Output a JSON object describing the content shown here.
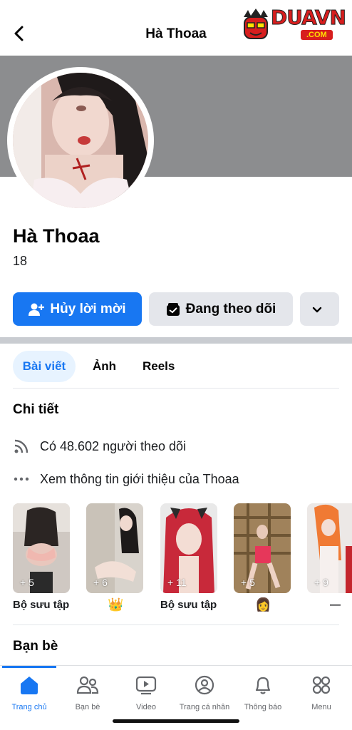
{
  "header": {
    "title": "Hà Thoaa",
    "back_icon": "chevron-left-icon"
  },
  "watermark": {
    "brand": "DUAVN",
    "suffix": ".COM",
    "colors": {
      "red": "#d71e1e",
      "yellow": "#ffe000"
    }
  },
  "profile": {
    "name": "Hà Thoaa",
    "subtitle": "18"
  },
  "actions": {
    "primary_label": "Hủy lời mời",
    "primary_icon": "person-add-icon",
    "secondary_label": "Đang theo dõi",
    "secondary_icon": "following-icon",
    "more_icon": "chevron-down-icon"
  },
  "tabs": [
    {
      "label": "Bài viết",
      "active": true
    },
    {
      "label": "Ảnh",
      "active": false
    },
    {
      "label": "Reels",
      "active": false
    }
  ],
  "details": {
    "title": "Chi tiết",
    "followers_text": "Có 48.602 người theo dõi",
    "followers_icon": "rss-icon",
    "about_text": "Xem thông tin giới thiệu của Thoaa",
    "about_icon": "more-dots-icon"
  },
  "collections": [
    {
      "count": "+ 5",
      "label": "Bộ sưu tập"
    },
    {
      "count": "+ 6",
      "label": "👑"
    },
    {
      "count": "+ 11",
      "label": "Bộ sưu tập"
    },
    {
      "count": "+ 5",
      "label": "👩"
    },
    {
      "count": "+ 9",
      "label": "—"
    }
  ],
  "friends": {
    "title": "Bạn bè"
  },
  "bottom_nav": [
    {
      "label": "Trang chủ",
      "icon": "home-icon",
      "active": true
    },
    {
      "label": "Bạn bè",
      "icon": "friends-icon",
      "active": false
    },
    {
      "label": "Video",
      "icon": "video-icon",
      "active": false
    },
    {
      "label": "Trang cá nhân",
      "icon": "profile-icon",
      "active": false
    },
    {
      "label": "Thông báo",
      "icon": "bell-icon",
      "active": false
    },
    {
      "label": "Menu",
      "icon": "menu-grid-icon",
      "active": false
    }
  ],
  "colors": {
    "accent": "#1877f2",
    "accent_light": "#e7f3ff",
    "secondary_button": "#e4e6eb",
    "cover": "#8c8d8f"
  }
}
